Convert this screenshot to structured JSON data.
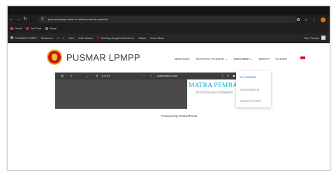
{
  "browser": {
    "url": "pusmar.lpmpp.unhas.ac.id/dokumen/sk-pusmar/",
    "bookmarks_row1": [
      "Gmail",
      "YouTube",
      "Maps"
    ],
    "bookmarks_row2": [
      "PUSMAR LPMPP",
      "Dokumen",
      "1",
      "1",
      "New",
      "Edit Laman",
      "Sunting dengan Elementor",
      "Status",
      "Rank Math"
    ],
    "greeting": "Hai, Pusmar",
    "accent_profile": "#e0731a"
  },
  "site": {
    "title": "PUSMAR LPMPP",
    "menu": [
      "BERANDA",
      "TENTANG PUSMAR ⌄",
      "DOKUMEN ⌄",
      "BERITA",
      "GALERI"
    ],
    "dropdown": [
      "SK PUSMAR",
      "SURAT MASUK",
      "SURAT KELUAR"
    ]
  },
  "viewer": {
    "page_info": "1 of 13",
    "zoom": "Automatic Zoom",
    "doc_title": "MATRA PEMBARU",
    "doc_subtitle": "Jurnal Inovasi Kebijakan"
  },
  "footer": {
    "powered_by": "Powered By EmbedPress"
  }
}
